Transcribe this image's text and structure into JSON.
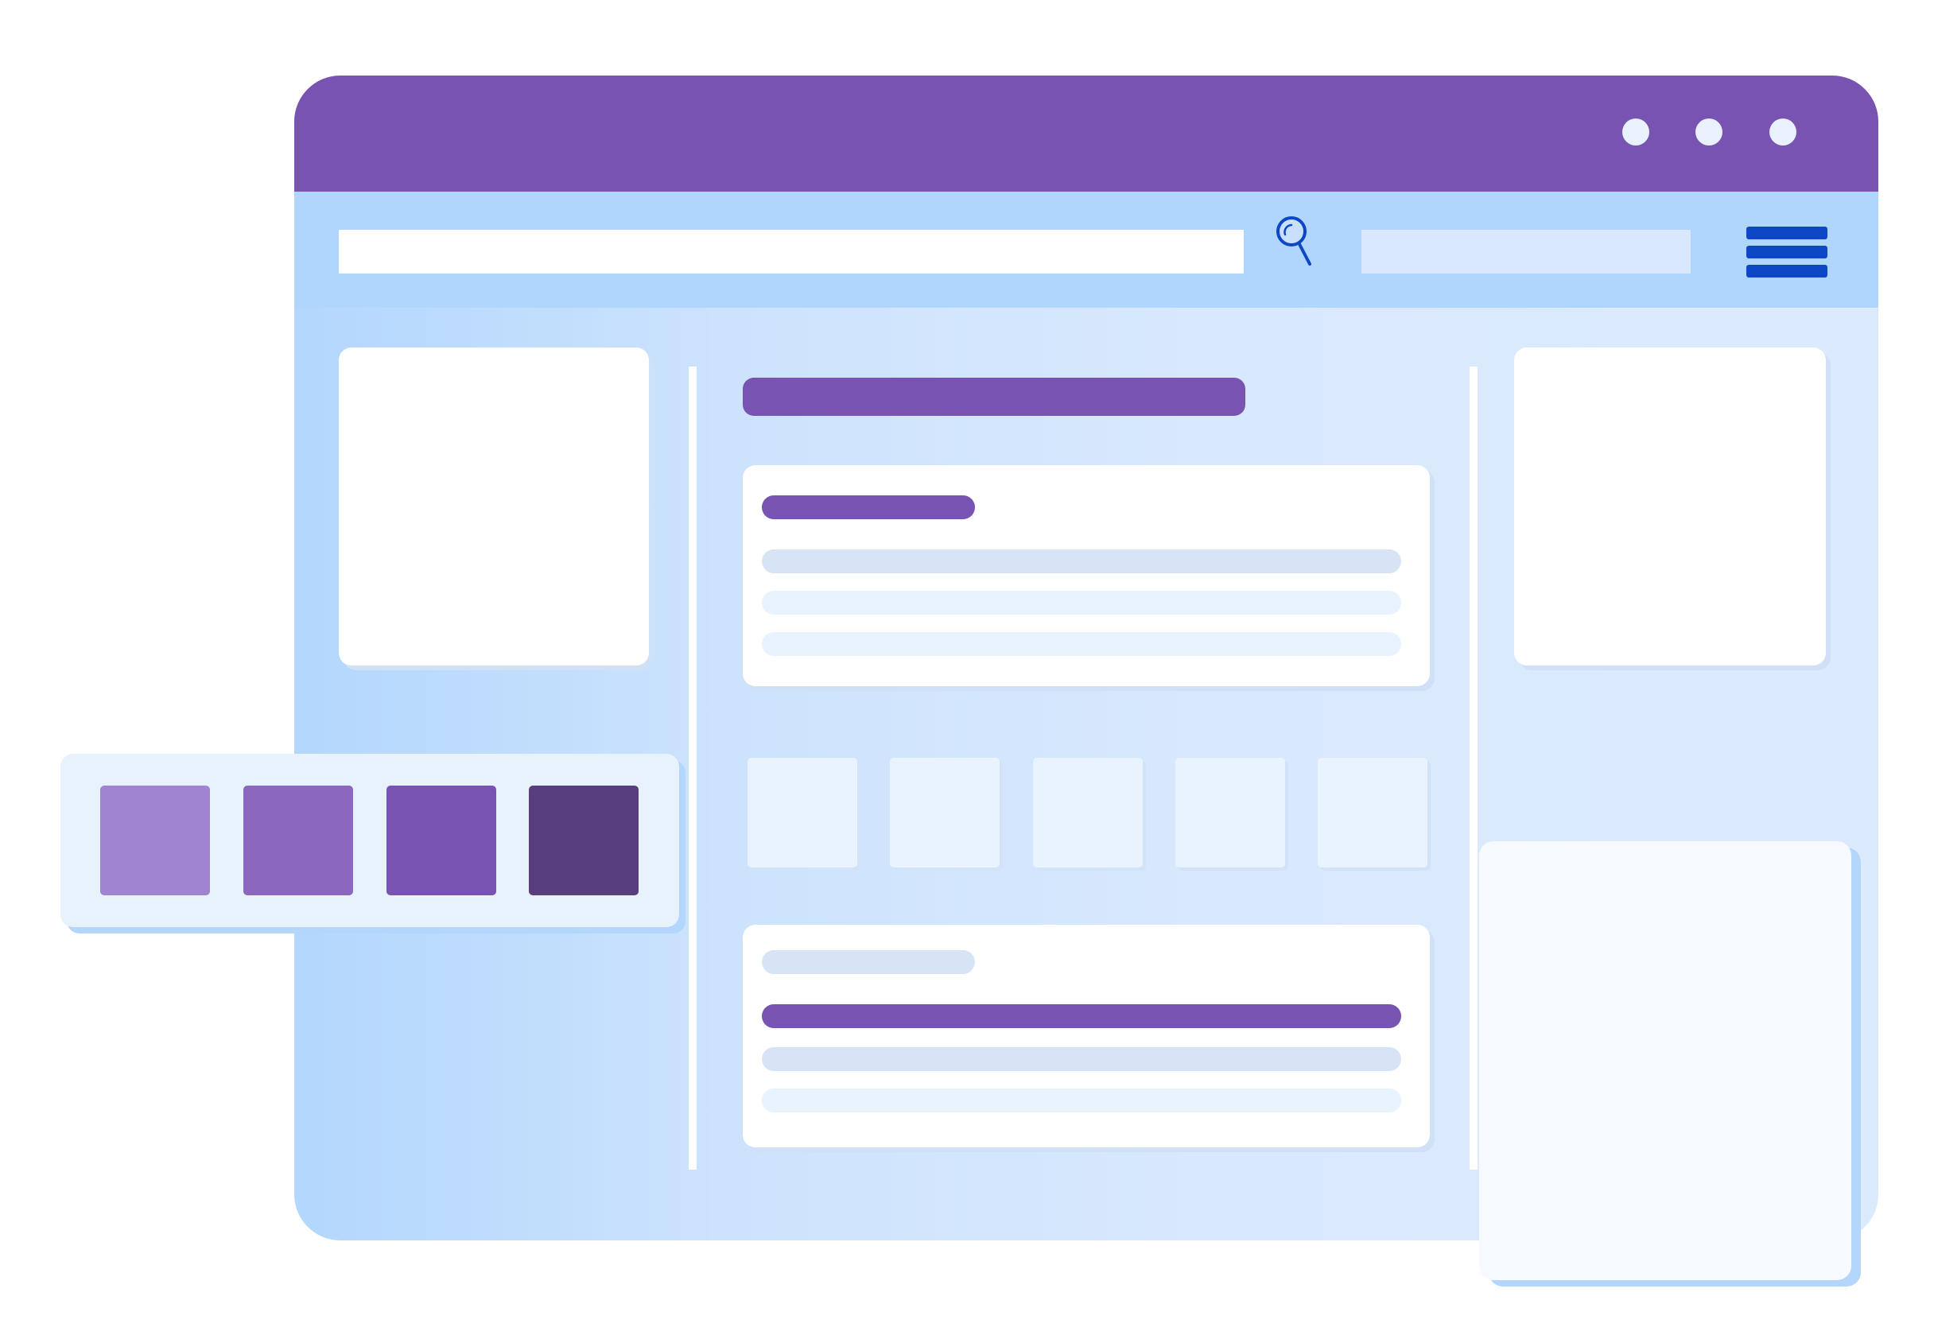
{
  "colors": {
    "accent": "#7953b2",
    "titlebar": "#7953b2",
    "toolbar": "#b1d6fd",
    "menu_icon": "#0d47c5",
    "skeleton_light": "#e8f3fd",
    "skeleton_mid": "#d6e4f6"
  },
  "window": {
    "controls": [
      "window-dot",
      "window-dot",
      "window-dot"
    ]
  },
  "toolbar": {
    "search_icon": "search-icon",
    "menu_icon": "hamburger-menu-icon",
    "search_value": "",
    "address_value": ""
  },
  "palette": {
    "swatches": [
      "#a084d2",
      "#8b67c0",
      "#7953b2",
      "#583e7d"
    ]
  }
}
